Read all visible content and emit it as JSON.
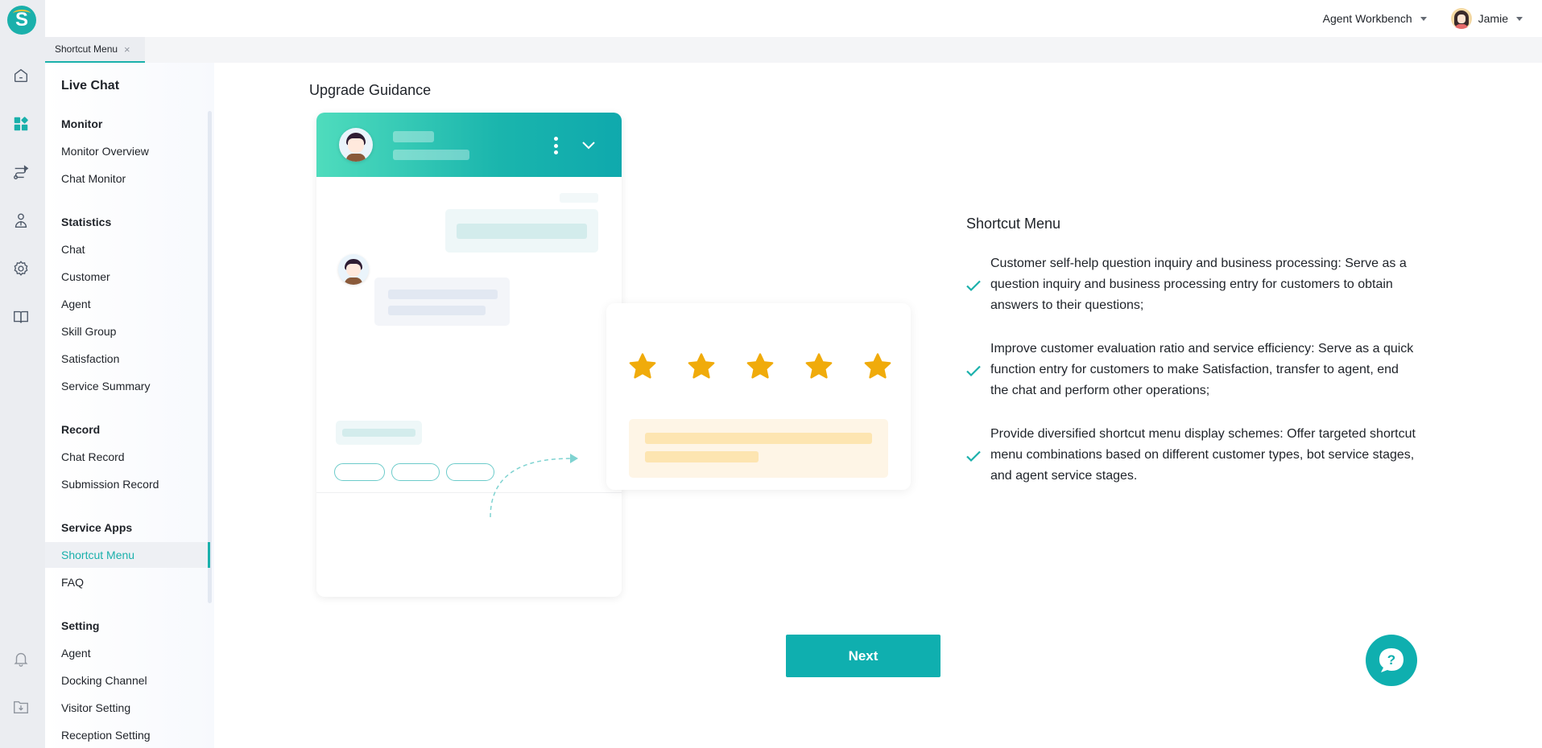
{
  "app": {
    "logo_letter": "S",
    "accent_color": "#1ab0ab"
  },
  "rail": {
    "items": [
      {
        "name": "home-icon"
      },
      {
        "name": "dashboard-icon",
        "active": true
      },
      {
        "name": "route-icon"
      },
      {
        "name": "agent-icon"
      },
      {
        "name": "settings-icon"
      },
      {
        "name": "book-icon"
      }
    ],
    "bottom_items": [
      {
        "name": "bell-icon"
      },
      {
        "name": "download-folder-icon"
      }
    ]
  },
  "topbar": {
    "workspace_label": "Agent Workbench",
    "user_name": "Jamie"
  },
  "tabs": [
    {
      "label": "Shortcut Menu",
      "active": true,
      "closable": true,
      "close_glyph": "×"
    }
  ],
  "nav": {
    "title": "Live Chat",
    "groups": [
      {
        "label": "Monitor",
        "items": [
          "Monitor Overview",
          "Chat Monitor"
        ]
      },
      {
        "label": "Statistics",
        "items": [
          "Chat",
          "Customer",
          "Agent",
          "Skill Group",
          "Satisfaction",
          "Service Summary"
        ]
      },
      {
        "label": "Record",
        "items": [
          "Chat Record",
          "Submission Record"
        ]
      },
      {
        "label": "Service Apps",
        "items": [
          "Shortcut Menu",
          "FAQ"
        ]
      },
      {
        "label": "Setting",
        "items": [
          "Agent",
          "Docking Channel",
          "Visitor Setting",
          "Reception Setting"
        ]
      }
    ],
    "active_item": "Shortcut Menu"
  },
  "main": {
    "page_title": "Upgrade Guidance",
    "illustration": {
      "rating_stars": 5,
      "rating_max": 5,
      "star_color": "#f0ab0b",
      "shortcut_pills": 3
    },
    "description": {
      "title": "Shortcut Menu",
      "items": [
        "Customer self-help question inquiry and business processing: Serve as a question inquiry and business processing entry for customers to obtain answers to their questions;",
        "Improve customer evaluation ratio and service efficiency: Serve as a quick function entry for customers to make Satisfaction, transfer to agent, end the chat and perform other operations;",
        "Provide diversified shortcut menu display schemes: Offer targeted shortcut menu combinations based on different customer types, bot service stages, and agent service stages."
      ]
    },
    "next_label": "Next",
    "help_glyph": "?"
  }
}
